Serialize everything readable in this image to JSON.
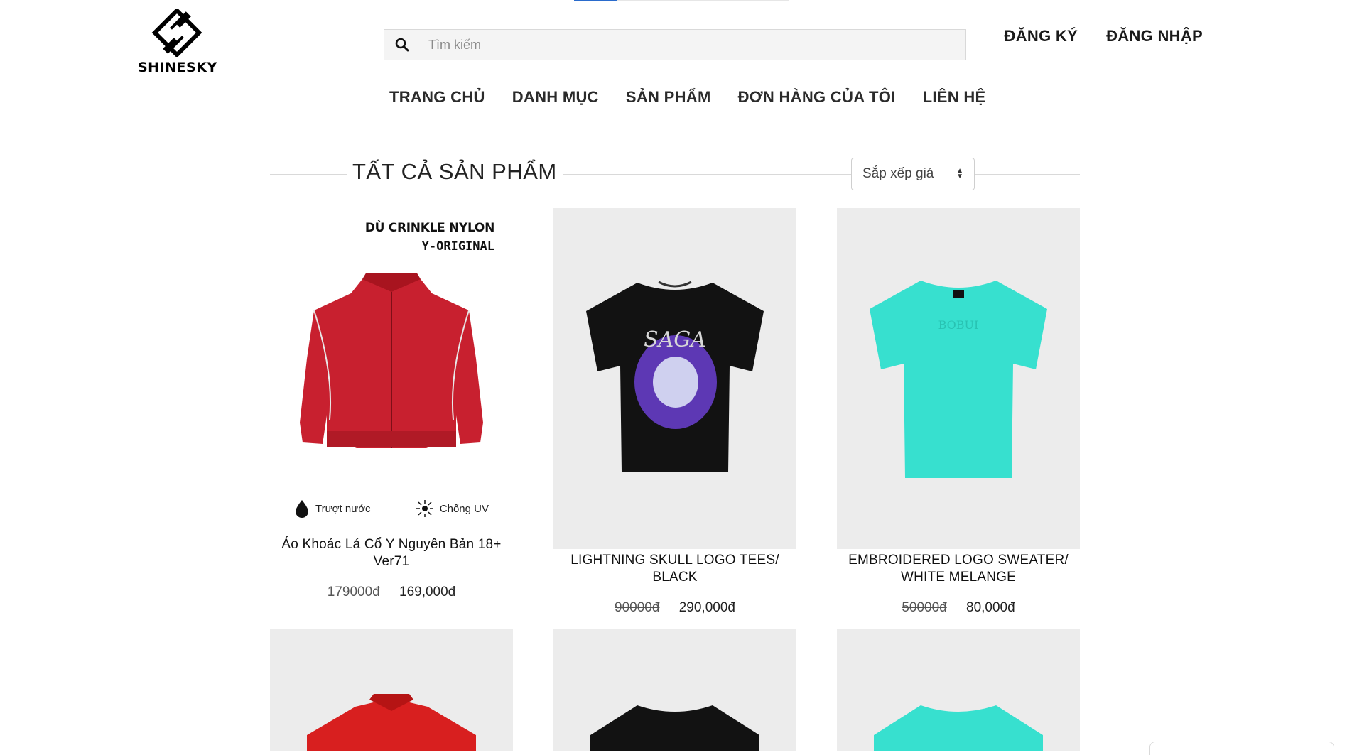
{
  "brand": {
    "name": "SHINESKY"
  },
  "search": {
    "placeholder": "Tìm kiếm"
  },
  "auth": {
    "register": "ĐĂNG KÝ",
    "login": "ĐĂNG NHẬP"
  },
  "nav": {
    "home": "TRANG CHỦ",
    "categories": "DANH MỤC",
    "products": "SẢN PHẨM",
    "orders": "ĐƠN HÀNG CỦA TÔI",
    "contact": "LIÊN HỆ"
  },
  "section": {
    "title": "TẤT CẢ SẢN PHẨM",
    "sort_label": "Sắp xếp giá"
  },
  "products": [
    {
      "name": "Áo Khoác Lá Cổ Y Nguyên Bản 18+ Ver71",
      "old_price": "179000đ",
      "price": "169,000đ",
      "image_text_1": "DÙ CRINKLE NYLON",
      "image_text_2": "Y-ORIGINAL",
      "feature_1": "Trượt nước",
      "feature_2": "Chống UV",
      "color": "#c8202f"
    },
    {
      "name": "LIGHTNING SKULL LOGO TEES/ BLACK",
      "old_price": "90000đ",
      "price": "290,000đ",
      "color": "#121212"
    },
    {
      "name": "EMBROIDERED LOGO SWEATER/ WHITE MELANGE",
      "old_price": "50000đ",
      "price": "80,000đ",
      "color": "#37e0cf"
    }
  ],
  "row2_colors": [
    "#d81f1f",
    "#121212",
    "#37e0cf"
  ]
}
